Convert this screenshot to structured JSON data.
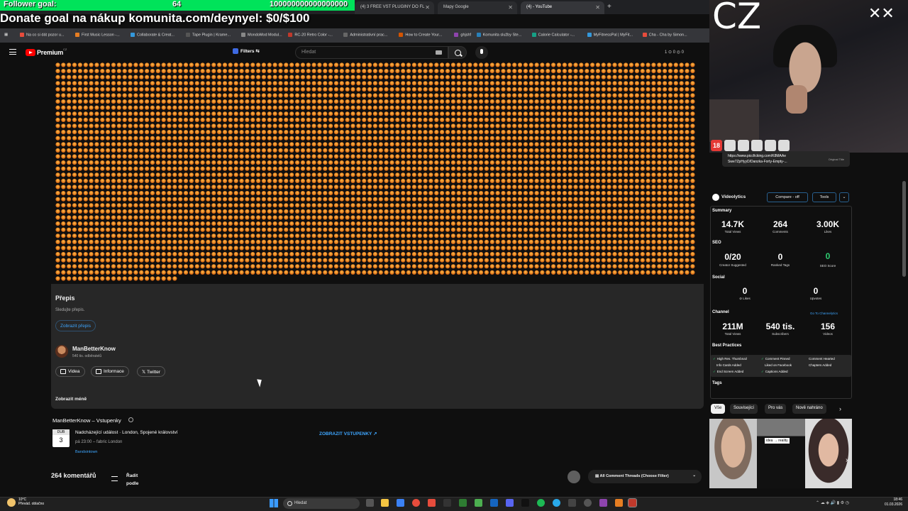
{
  "overlay": {
    "follower_goal_label": "Follower goal:",
    "follower_current": "64",
    "follower_target": "100000000000000000",
    "donate_text": "Donate goal na nákup komunita.com/deynyel: $0/$100",
    "cam_label": "CZ"
  },
  "browser": {
    "tabs": [
      {
        "title": "(4) 3 FREE VST PLUGINY DO FL"
      },
      {
        "title": "Mapy Google"
      },
      {
        "title": "(4) - YouTube"
      }
    ],
    "bookmarks": [
      "Na co si dát pozor u...",
      "First Music Lesson -...",
      "Collaborate & Creat...",
      "Tape Plugin | Krame...",
      "MondoMod Modul...",
      "RC-20 Retro Color -...",
      "Administrativní prac...",
      "How to Create Your...",
      "ghjshf",
      "Komunita služby Ste...",
      "Calorie Calculator -...",
      "MyFitnessPal | MyFit...",
      "Cha - Cha by Simon..."
    ]
  },
  "youtube": {
    "logo_text": "Premium",
    "region": "CZ",
    "filters_label": "Filters",
    "search_placeholder": "Hledat",
    "header_stats": "1 ⊙ 0 ◎ 0",
    "transcript": {
      "title": "Přepis",
      "subtitle": "Sledujte přepis.",
      "button": "Zobrazit přepis"
    },
    "channel": {
      "name": "ManBetterKnow",
      "subs": "540 tis. odběratelů",
      "buttons": [
        "Videa",
        "Informace",
        "Twitter"
      ]
    },
    "show_less": "Zobrazit méně",
    "tickets": {
      "title": "ManBetterKnow – Vstupenky",
      "month": "DUB",
      "day": "3",
      "event": "Nadcházející událost · London, Spojené království",
      "time": "pá 23:00 – fabric London",
      "source": "Bandsintown",
      "button": "ZOBRAZIT VSTUPENKY ↗"
    },
    "comments": {
      "count": "264 komentářů",
      "sort_label": "Řadit podle",
      "threads": "All Comment Threads (Choose Filter)"
    }
  },
  "sidebar": {
    "link_card": {
      "line1": "https://www.piccficking.com/K8MAAe",
      "line2": "Swe7ZpHyyD/Danzka-Forty-Empty-...",
      "orig": "Original Title"
    },
    "videolytics": {
      "title": "Videolytics",
      "compare": "Compare - off",
      "tools": "Tools",
      "caret": "⌄",
      "summary_label": "Summary",
      "summary": [
        {
          "v": "14.7K",
          "l": "Total Views"
        },
        {
          "v": "264",
          "l": "Comments"
        },
        {
          "v": "3.00K",
          "l": "Likes"
        }
      ],
      "seo_label": "SEO",
      "seo": [
        {
          "v": "0/20",
          "l": "Creator Suggested"
        },
        {
          "v": "0",
          "l": "Ranked Tags"
        },
        {
          "v": "0",
          "l": "SEO Score"
        }
      ],
      "social_label": "Social",
      "social": [
        {
          "v": "0",
          "l": "⊘ Likes"
        },
        {
          "v": "0",
          "l": "Upvotes"
        }
      ],
      "channel_label": "Channel",
      "channel_link": "Go To Channelytics",
      "channel": [
        {
          "v": "211M",
          "l": "Total Views"
        },
        {
          "v": "540 tis.",
          "l": "Subscribers"
        },
        {
          "v": "156",
          "l": "Videos"
        }
      ],
      "bp_label": "Best Practices",
      "bp": [
        "High Res. Thumbnail",
        "Comment Pinned",
        "Comment Hearted",
        "Info Cards Added",
        "Liked on Facebook",
        "Chapters Added",
        "End Screen Added",
        "Captions Added"
      ],
      "tags_label": "Tags"
    },
    "chips": [
      "Vše",
      "Související",
      "Pro vás",
      "Nově nahráno"
    ],
    "thumb_label": "idea → reality"
  },
  "taskbar": {
    "temp": "10°C",
    "weather": "Převád. oblačno",
    "search": "Hledat",
    "time": "18:46",
    "date": "01.03.2026"
  },
  "colors": {
    "accent": "#3ea6ff",
    "yt_red": "#ff0000",
    "green": "#00e35a"
  }
}
